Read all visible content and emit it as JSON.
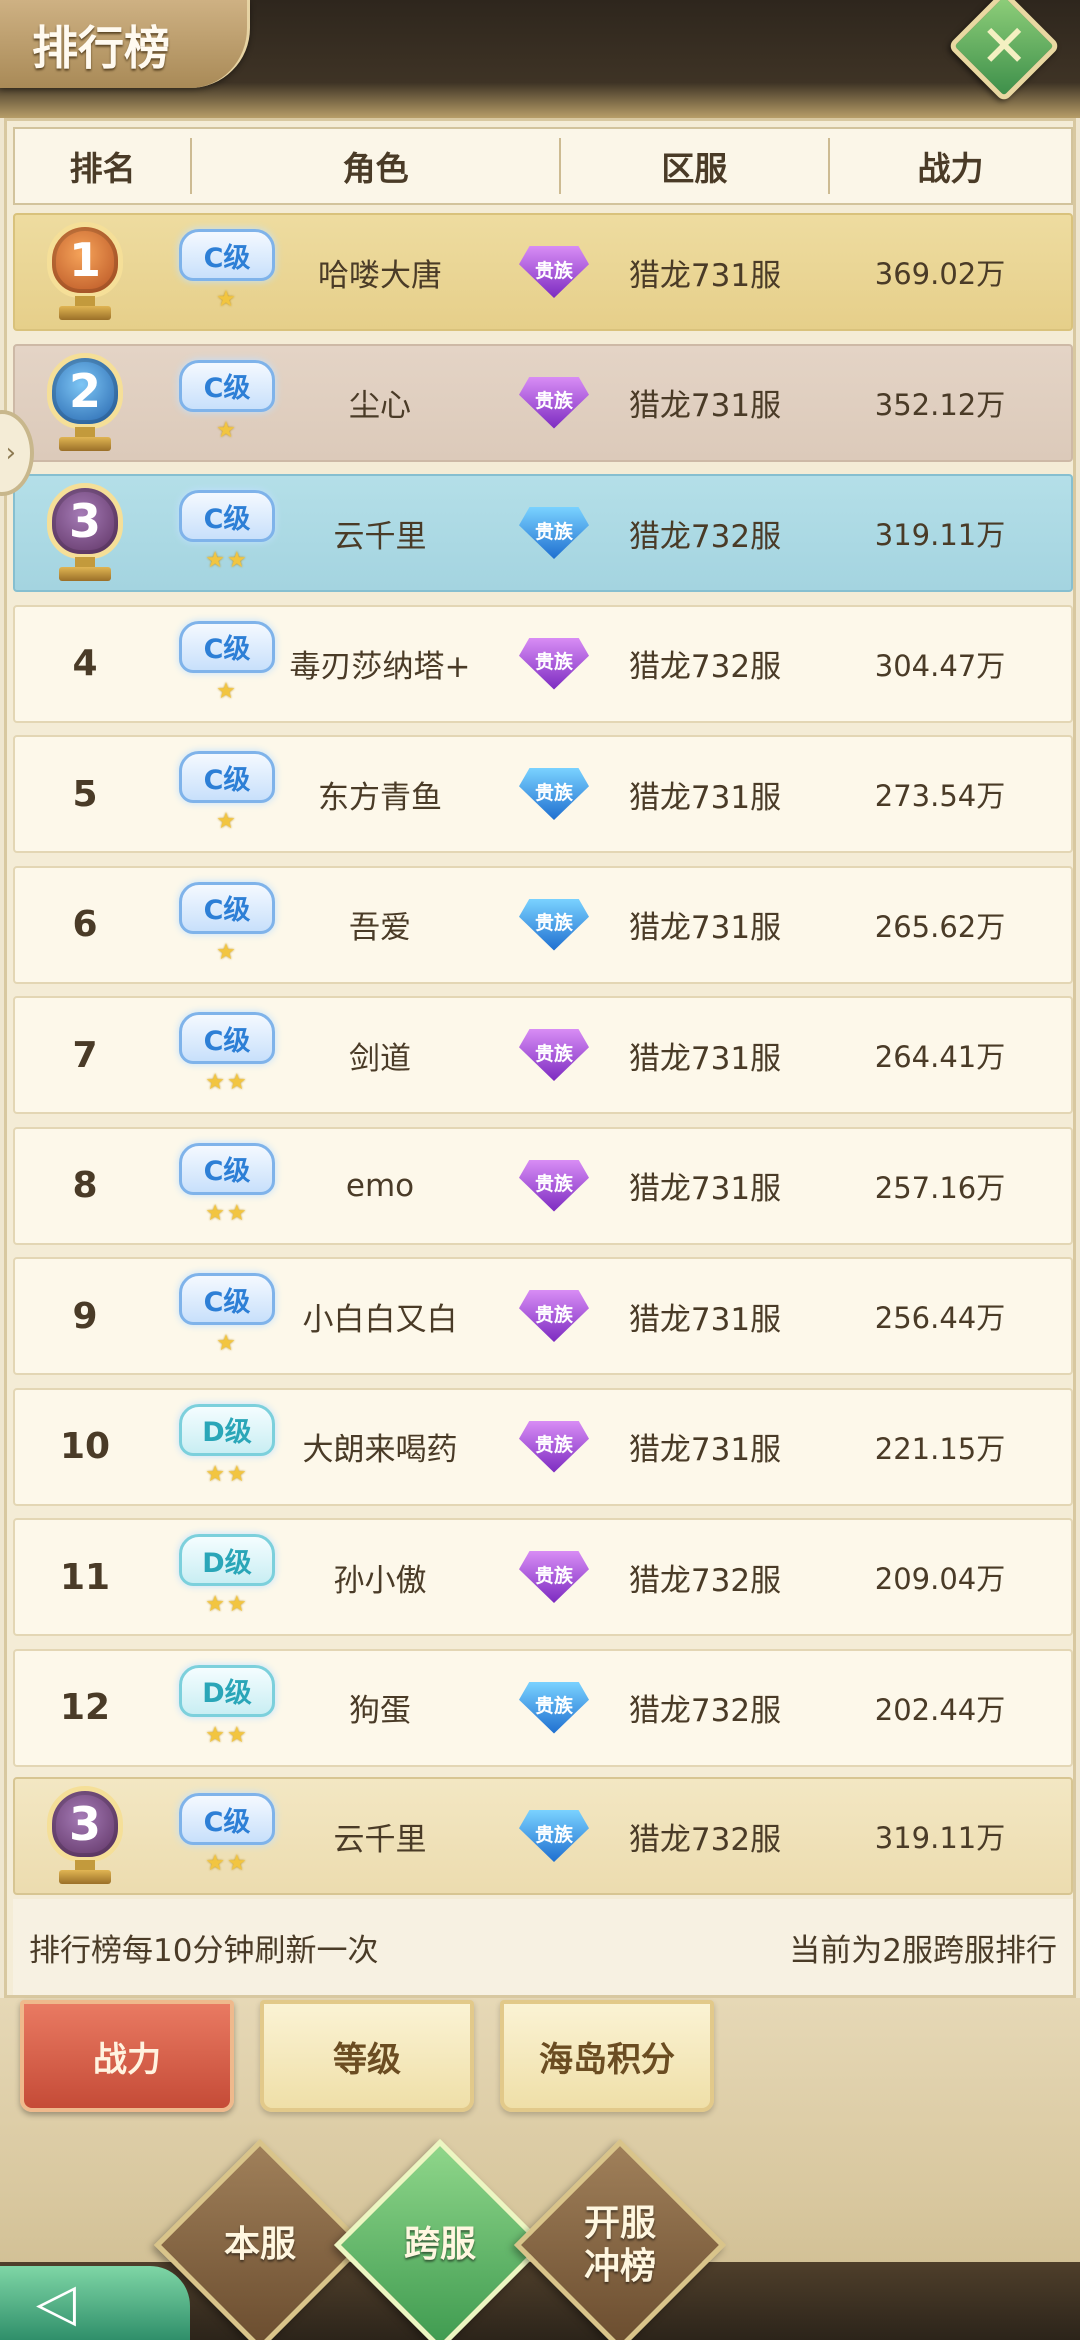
{
  "header": {
    "title": "排行榜",
    "close_icon": "close-x-icon"
  },
  "columns": [
    "排名",
    "角色",
    "区服",
    "战力"
  ],
  "rows": [
    {
      "rank": "1",
      "trophy": "gold",
      "grade": "C级",
      "stars": "★",
      "name": "哈喽大唐",
      "noble": "贵族",
      "noble_color": "purple",
      "server": "猎龙731服",
      "power": "369.02万"
    },
    {
      "rank": "2",
      "trophy": "silver",
      "grade": "C级",
      "stars": "★",
      "name": "尘心",
      "noble": "贵族",
      "noble_color": "purple",
      "server": "猎龙731服",
      "power": "352.12万"
    },
    {
      "rank": "3",
      "trophy": "bronze",
      "grade": "C级",
      "stars": "★★",
      "name": "云千里",
      "noble": "贵族",
      "noble_color": "blue",
      "server": "猎龙732服",
      "power": "319.11万"
    },
    {
      "rank": "4",
      "grade": "C级",
      "stars": "★",
      "name": "毒刃莎纳塔+",
      "noble": "贵族",
      "noble_color": "purple",
      "server": "猎龙732服",
      "power": "304.47万"
    },
    {
      "rank": "5",
      "grade": "C级",
      "stars": "★",
      "name": "东方青鱼",
      "noble": "贵族",
      "noble_color": "blue",
      "server": "猎龙731服",
      "power": "273.54万"
    },
    {
      "rank": "6",
      "grade": "C级",
      "stars": "★",
      "name": "吾爱",
      "noble": "贵族",
      "noble_color": "blue",
      "server": "猎龙731服",
      "power": "265.62万"
    },
    {
      "rank": "7",
      "grade": "C级",
      "stars": "★★",
      "name": "剑道",
      "noble": "贵族",
      "noble_color": "purple",
      "server": "猎龙731服",
      "power": "264.41万"
    },
    {
      "rank": "8",
      "grade": "C级",
      "stars": "★★",
      "name": "emo",
      "noble": "贵族",
      "noble_color": "purple",
      "server": "猎龙731服",
      "power": "257.16万"
    },
    {
      "rank": "9",
      "grade": "C级",
      "stars": "★",
      "name": "小白白又白",
      "noble": "贵族",
      "noble_color": "purple",
      "server": "猎龙731服",
      "power": "256.44万"
    },
    {
      "rank": "10",
      "grade": "D级",
      "stars": "★★",
      "name": "大朗来喝药",
      "noble": "贵族",
      "noble_color": "purple",
      "server": "猎龙731服",
      "power": "221.15万"
    },
    {
      "rank": "11",
      "grade": "D级",
      "stars": "★★",
      "name": "孙小傲",
      "noble": "贵族",
      "noble_color": "purple",
      "server": "猎龙732服",
      "power": "209.04万"
    },
    {
      "rank": "12",
      "grade": "D级",
      "stars": "★★",
      "name": "狗蛋",
      "noble": "贵族",
      "noble_color": "blue",
      "server": "猎龙732服",
      "power": "202.44万"
    }
  ],
  "self": {
    "rank": "3",
    "trophy": "bronze",
    "grade": "C级",
    "stars": "★★",
    "name": "云千里",
    "noble": "贵族",
    "noble_color": "blue",
    "server": "猎龙732服",
    "power": "319.11万"
  },
  "footer": {
    "refresh_note": "排行榜每10分钟刷新一次",
    "scope_note": "当前为2服跨服排行"
  },
  "tabs": [
    {
      "label": "战力",
      "active": true
    },
    {
      "label": "等级",
      "active": false
    },
    {
      "label": "海岛积分",
      "active": false
    }
  ],
  "scope_buttons": [
    {
      "label": "本服",
      "active": false
    },
    {
      "label": "跨服",
      "active": true
    },
    {
      "label": "开服\n冲榜",
      "active": false
    }
  ],
  "side_handle_icon": "chevron-right-icon",
  "back_icon": "back-arrow-icon"
}
